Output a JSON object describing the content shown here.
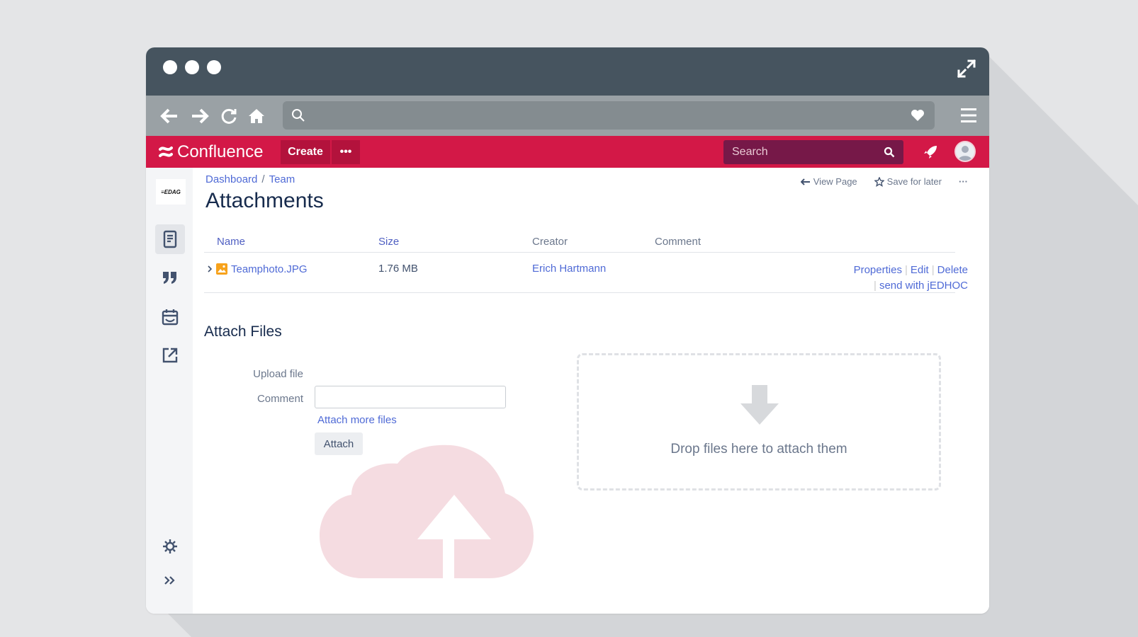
{
  "browser": {
    "address": ""
  },
  "confluence": {
    "logo_text": "Confluence",
    "create_label": "Create",
    "more_label": "•••",
    "search_placeholder": "Search"
  },
  "sidebar": {
    "space_logo_text": "≡EDAG",
    "items": [
      {
        "icon": "pages-icon",
        "active": true
      },
      {
        "icon": "blog-quote-icon",
        "active": false
      },
      {
        "icon": "calendar-icon",
        "active": false
      },
      {
        "icon": "external-link-icon",
        "active": false
      }
    ],
    "bottom": [
      {
        "icon": "settings-icon"
      },
      {
        "icon": "expand-sidebar-icon"
      }
    ]
  },
  "page": {
    "breadcrumb": [
      "Dashboard",
      "Team"
    ],
    "breadcrumb_sep": "/",
    "title": "Attachments",
    "actions": {
      "view_page": "View Page",
      "save_for_later": "Save for later",
      "more": "···"
    }
  },
  "table": {
    "headers": {
      "name": "Name",
      "size": "Size",
      "creator": "Creator",
      "comment": "Comment"
    },
    "rows": [
      {
        "name": "Teamphoto.JPG",
        "size": "1.76 MB",
        "creator": "Erich Hartmann",
        "comment": "",
        "actions": {
          "properties": "Properties",
          "edit": "Edit",
          "delete": "Delete",
          "send": "send with jEDHOC"
        }
      }
    ]
  },
  "attach": {
    "title": "Attach Files",
    "upload_label": "Upload file",
    "comment_label": "Comment",
    "comment_value": "",
    "more_files": "Attach more files",
    "attach_button": "Attach",
    "drop_text": "Drop files here to attach them"
  },
  "colors": {
    "confluence_red": "#d31847",
    "titlebar": "#46545f",
    "link_blue": "#4f6ad6"
  }
}
